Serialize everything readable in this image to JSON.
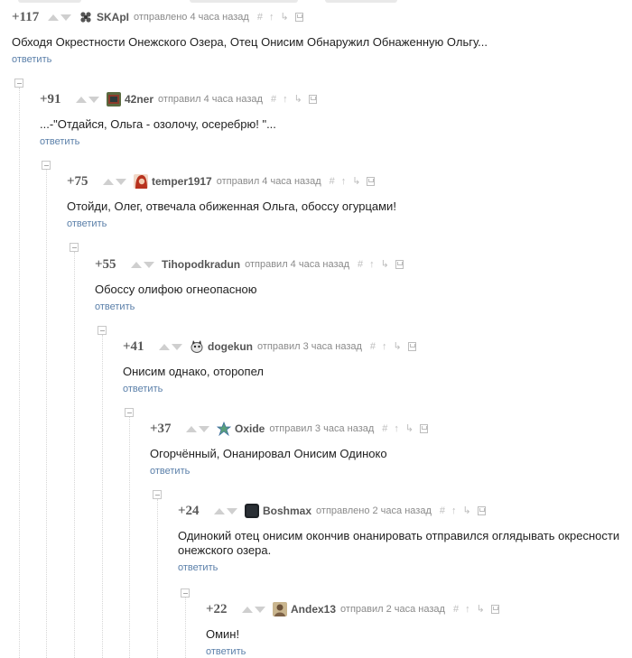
{
  "ui": {
    "reply_label": "ответить"
  },
  "comments": [
    {
      "rating": "+117",
      "nick": "SKApI",
      "meta": "отправлено 4 часа назад",
      "text": "Обходя Окрестности Онежского Озера, Отец Онисим Обнаружил Обнаженную Ольгу..."
    },
    {
      "rating": "+91",
      "nick": "42ner",
      "meta": "отправил 4 часа назад",
      "text": "...-\"Отдайся, Ольга - озолочу, осеребрю! \"..."
    },
    {
      "rating": "+75",
      "nick": "temper1917",
      "meta": "отправил 4 часа назад",
      "text": "Отойди, Олег, отвечала обиженная Ольга, обоссу огурцами!"
    },
    {
      "rating": "+55",
      "nick": "Tihopodkradun",
      "meta": "отправил 4 часа назад",
      "text": "Обоссу олифою огнеопасною"
    },
    {
      "rating": "+41",
      "nick": "dogekun",
      "meta": "отправил 3 часа назад",
      "text": "Онисим однако, оторопел"
    },
    {
      "rating": "+37",
      "nick": "Oxide",
      "meta": "отправил 3 часа назад",
      "text": "Огорчённый, Онанировал Онисим Одиноко"
    },
    {
      "rating": "+24",
      "nick": "Boshmax",
      "meta": "отправлено 2 часа назад",
      "text": "Одинокий отец онисим окончив онанировать отправился оглядывать окресности онежского озера."
    },
    {
      "rating": "+22",
      "nick": "Andex13",
      "meta": "отправил 2 часа назад",
      "text": "Омин!"
    }
  ]
}
